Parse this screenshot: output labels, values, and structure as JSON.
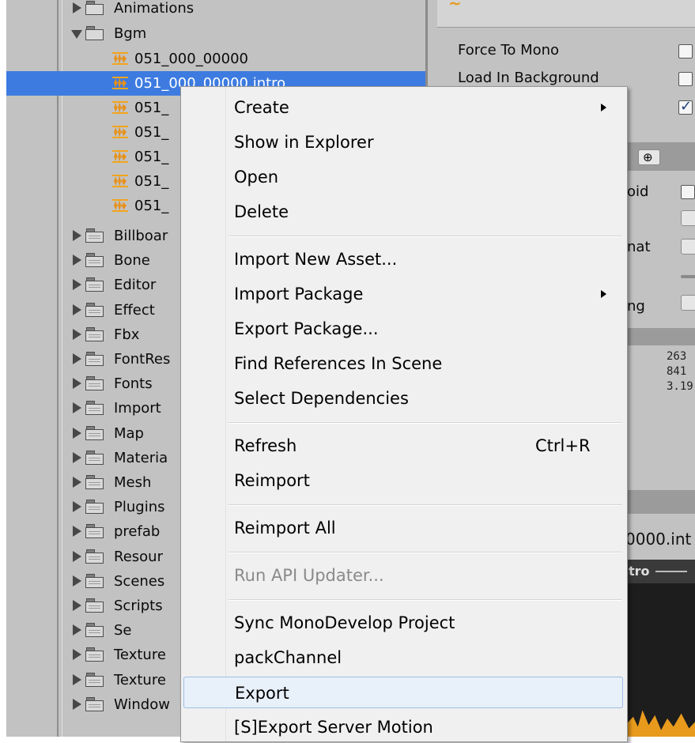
{
  "tree": {
    "parent_top": "Animations",
    "open_folder": "Bgm",
    "selected_file": "051_000_00000.intro",
    "files": [
      "051_000_00000",
      "051_000_00000.intro",
      "051_",
      "051_",
      "051_",
      "051_",
      "051_"
    ],
    "folders": [
      "Billboar",
      "Bone",
      "Editor",
      "Effect",
      "Fbx",
      "FontRes",
      "Fonts",
      "Import",
      "Map",
      "Materia",
      "Mesh",
      "Plugins",
      "prefab",
      "Resour",
      "Scenes",
      "Scripts",
      "Se",
      "Texture",
      "Texture",
      "Window"
    ]
  },
  "inspector": {
    "force_to_mono_label": "Force To Mono",
    "force_to_mono_checked": false,
    "load_in_background_label": "Load In Background",
    "load_in_background_checked": false,
    "third_checked": true,
    "android_partial": "oid",
    "format_partial": "nat",
    "loading_partial": "ng",
    "info_lines": [
      "263",
      "841",
      "3.19"
    ],
    "filename_partial": "0000.int",
    "preview_partial": "tro"
  },
  "menu": {
    "items": [
      {
        "label": "Create",
        "submenu": true
      },
      {
        "label": "Show in Explorer"
      },
      {
        "label": "Open"
      },
      {
        "label": "Delete"
      },
      {
        "label": "Import New Asset..."
      },
      {
        "label": "Import Package",
        "submenu": true
      },
      {
        "label": "Export Package..."
      },
      {
        "label": "Find References In Scene"
      },
      {
        "label": "Select Dependencies"
      },
      {
        "label": "Refresh",
        "shortcut": "Ctrl+R"
      },
      {
        "label": "Reimport"
      },
      {
        "label": "Reimport All"
      },
      {
        "label": "Run API Updater...",
        "disabled": true
      },
      {
        "label": "Sync MonoDevelop Project"
      },
      {
        "label": "packChannel"
      },
      {
        "label": "Export",
        "hover": true
      },
      {
        "label": "[S]Export Server Motion"
      }
    ]
  },
  "colors": {
    "selection": "#3d7be0",
    "menu_bg": "#f0f0f0",
    "hover_bg": "#e8f0fa",
    "audio_icon": "#e8911a",
    "disabled_text": "#8a8a8a"
  }
}
